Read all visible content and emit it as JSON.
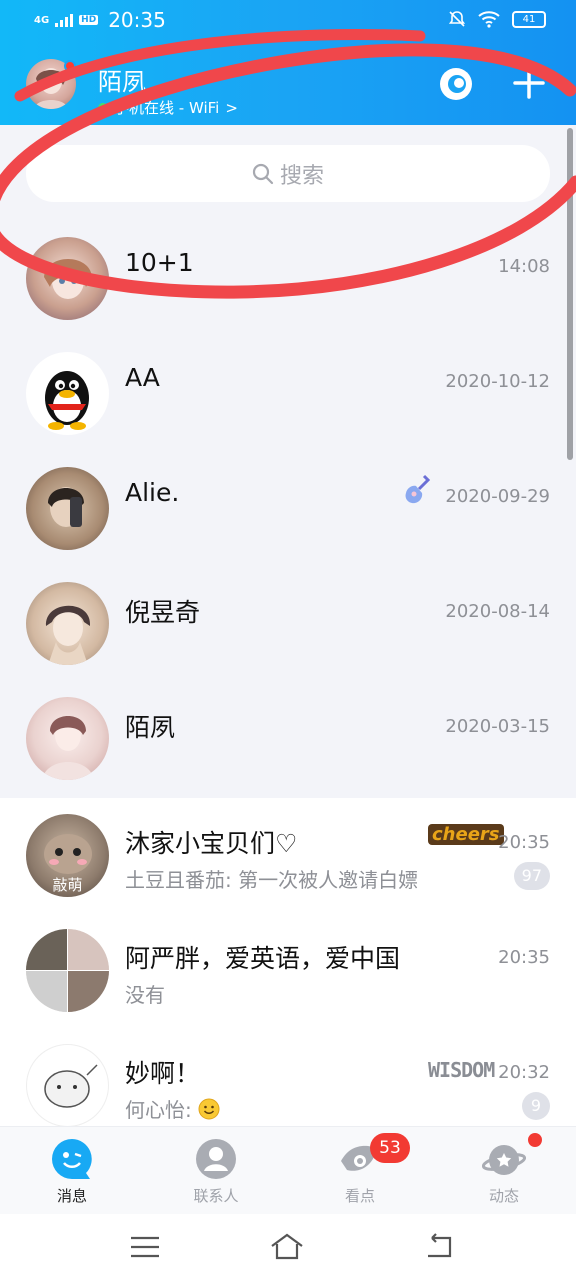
{
  "status_bar": {
    "network": "4G",
    "hd": "HD",
    "time": "20:35",
    "battery": "41"
  },
  "profile": {
    "name": "陌夙",
    "status": "手机在线 - WiFi",
    "status_chevron": ">"
  },
  "search": {
    "placeholder": "搜索"
  },
  "pinned_chats": [
    {
      "name": "10+1",
      "time": "14:08"
    },
    {
      "name": "AA",
      "time": "2020-10-12"
    },
    {
      "name": "Alie.",
      "time": "2020-09-29"
    },
    {
      "name": "倪昱奇",
      "time": "2020-08-14"
    },
    {
      "name": "陌夙",
      "time": "2020-03-15"
    }
  ],
  "chats": [
    {
      "name": "沐家小宝贝们♡",
      "time": "20:35",
      "preview": "土豆且番茄: 第一次被人邀请白嫖",
      "unread": "97",
      "sticker": "cheers",
      "avatar_text": "敲萌"
    },
    {
      "name": "阿严胖，爱英语，爱中国",
      "time": "20:35",
      "preview": "没有"
    },
    {
      "name": "妙啊！",
      "time": "20:32",
      "preview": "何心怡:",
      "unread": "9",
      "sticker": "WISDOM"
    }
  ],
  "bottom_nav": [
    {
      "label": "消息",
      "active": true
    },
    {
      "label": "联系人"
    },
    {
      "label": "看点",
      "badge": "53"
    },
    {
      "label": "动态"
    }
  ],
  "colors": {
    "header": "#1aa4f4",
    "accent_red": "#f23a33",
    "marker": "#f0474b"
  }
}
